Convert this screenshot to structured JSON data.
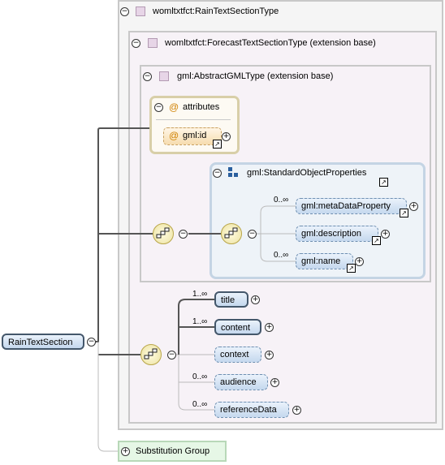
{
  "root": {
    "label": "RainTextSection"
  },
  "type_box": {
    "label": "womltxtfct:RainTextSectionType"
  },
  "base1": {
    "label": "womltxtfct:ForecastTextSectionType (extension base)"
  },
  "base2": {
    "label": "gml:AbstractGMLType (extension base)"
  },
  "attributes": {
    "label": "attributes",
    "symbol": "@",
    "items": [
      {
        "symbol": "@",
        "label": "gml:id"
      }
    ]
  },
  "group": {
    "label": "gml:StandardObjectProperties",
    "items": [
      {
        "label": "gml:metaDataProperty",
        "multiplicity": "0..∞"
      },
      {
        "label": "gml:description",
        "multiplicity": ""
      },
      {
        "label": "gml:name",
        "multiplicity": "0..∞"
      }
    ]
  },
  "sequence": [
    {
      "label": "title",
      "multiplicity": "1..∞"
    },
    {
      "label": "content",
      "multiplicity": "1..∞"
    },
    {
      "label": "context",
      "multiplicity": ""
    },
    {
      "label": "audience",
      "multiplicity": "0..∞"
    },
    {
      "label": "referenceData",
      "multiplicity": "0..∞"
    }
  ],
  "substitution": {
    "label": "Substitution Group"
  },
  "colors": {
    "element_fill": "#c5d8ee",
    "type_fill": "#f7f2f7",
    "compositor": "#ece2a0",
    "substitution_fill": "#e6f7e6"
  },
  "icons": {
    "collapse": "minus-circle-icon",
    "expand": "plus-circle-icon",
    "reference": "arrow-ref-icon",
    "sequence": "sequence-compositor-icon",
    "group": "group-icon",
    "type": "type-icon",
    "attribute": "at-icon"
  }
}
